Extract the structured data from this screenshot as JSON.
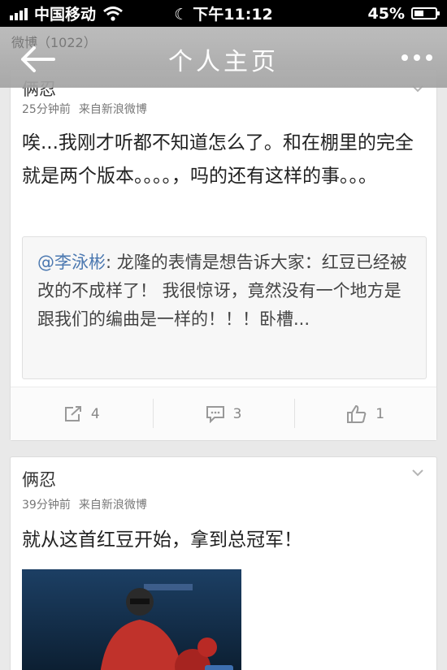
{
  "status": {
    "carrier": "中国移动",
    "time": "下午11:12",
    "battery": "45%",
    "battery_level": 0.45
  },
  "nav": {
    "subtitle": "微博（1022）",
    "title": "个人主页"
  },
  "posts": [
    {
      "author": "俩忍",
      "time": "25分钟前",
      "source": "来自新浪微博",
      "text": "唉...我刚才听都不知道怎么了。和在棚里的完全就是两个版本。。。。，吗的还有这样的事。。。",
      "quote_mention": "@李泳彬",
      "quote_text": ": 龙隆的表情是想告诉大家：红豆已经被改的不成样了！ 我很惊讶，竟然没有一个地方是跟我们的编曲是一样的！！！卧槽...",
      "reposts": "4",
      "comments": "3",
      "likes": "1"
    },
    {
      "author": "俩忍",
      "time": "39分钟前",
      "source": "来自新浪微博",
      "text": "就从这首红豆开始，拿到总冠军！"
    }
  ]
}
